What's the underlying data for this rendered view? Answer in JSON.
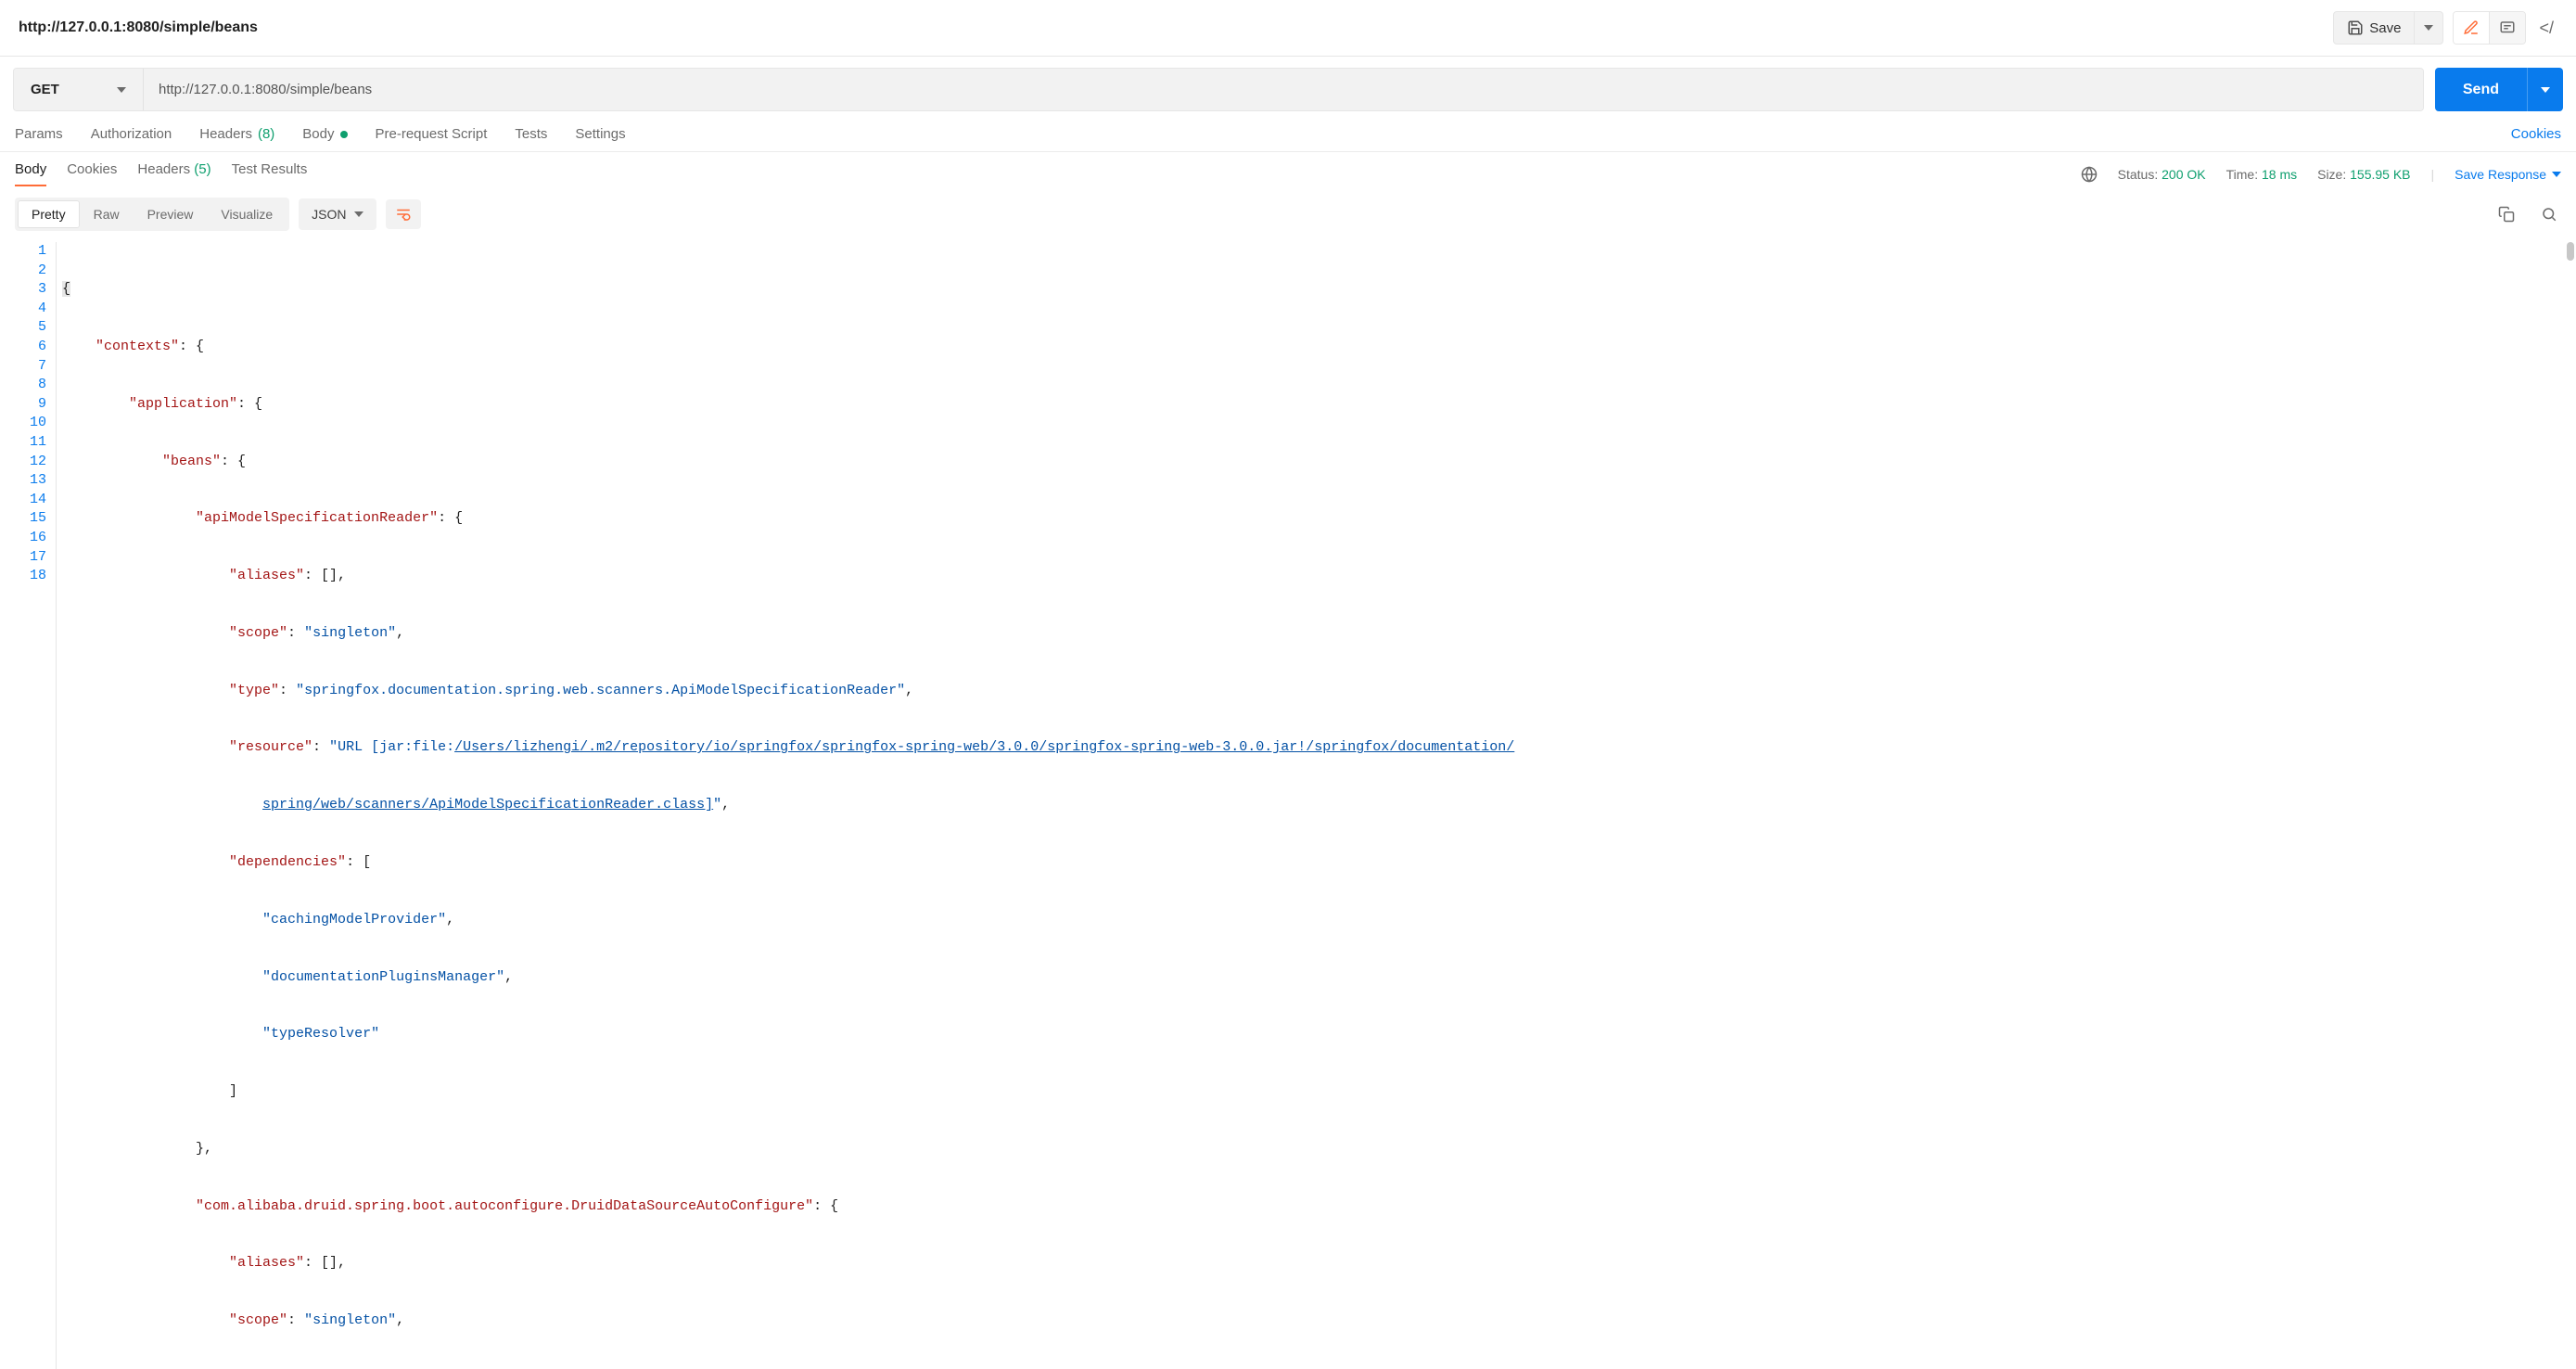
{
  "topbar": {
    "title": "http://127.0.0.1:8080/simple/beans",
    "save_label": "Save"
  },
  "request": {
    "method": "GET",
    "url": "http://127.0.0.1:8080/simple/beans",
    "send_label": "Send"
  },
  "req_tabs": {
    "params": "Params",
    "authorization": "Authorization",
    "headers": "Headers",
    "headers_count": "(8)",
    "body": "Body",
    "pre_request": "Pre-request Script",
    "tests": "Tests",
    "settings": "Settings",
    "cookies": "Cookies"
  },
  "resp_tabs": {
    "body": "Body",
    "cookies": "Cookies",
    "headers": "Headers",
    "headers_count": "(5)",
    "test_results": "Test Results"
  },
  "resp_meta": {
    "status_label": "Status:",
    "status_value": "200 OK",
    "time_label": "Time:",
    "time_value": "18 ms",
    "size_label": "Size:",
    "size_value": "155.95 KB",
    "save_response": "Save Response"
  },
  "view": {
    "pretty": "Pretty",
    "raw": "Raw",
    "preview": "Preview",
    "visualize": "Visualize",
    "format": "JSON"
  },
  "code_lines": [
    "1",
    "2",
    "3",
    "4",
    "5",
    "6",
    "7",
    "8",
    "9",
    "10",
    "11",
    "12",
    "13",
    "14",
    "15",
    "16",
    "17",
    "18"
  ],
  "json_body": {
    "contexts": {
      "application": {
        "beans": {
          "apiModelSpecificationReader": {
            "aliases": [],
            "scope": "singleton",
            "type": "springfox.documentation.spring.web.scanners.ApiModelSpecificationReader",
            "resource": "URL [jar:file:/Users/lizhengi/.m2/repository/io/springfox/springfox-spring-web/3.0.0/springfox-spring-web-3.0.0.jar!/springfox/documentation/spring/web/scanners/ApiModelSpecificationReader.class]",
            "dependencies": [
              "cachingModelProvider",
              "documentationPluginsManager",
              "typeResolver"
            ]
          },
          "com.alibaba.druid.spring.boot.autoconfigure.DruidDataSourceAutoConfigure": {
            "aliases": [],
            "scope": "singleton"
          }
        }
      }
    }
  },
  "resource_link_1": "/Users/lizhengi/.m2/repository/io/springfox/springfox-spring-web/3.0.0/springfox-spring-web-3.0.0.jar!/springfox/documentation/",
  "resource_link_2": "spring/web/scanners/ApiModelSpecificationReader.class]"
}
